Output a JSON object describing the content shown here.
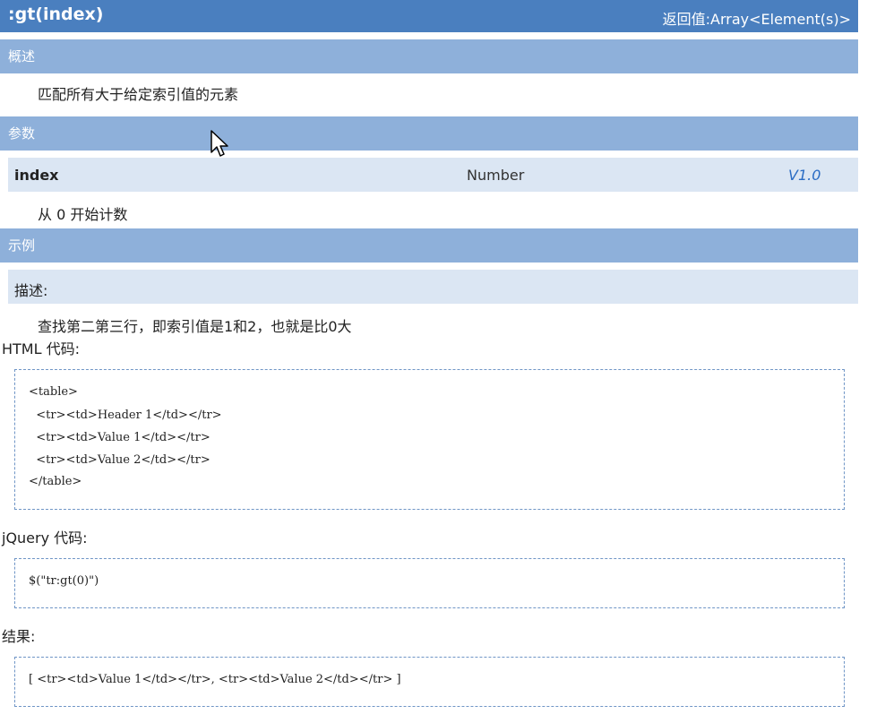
{
  "header": {
    "title": ":gt(index)",
    "return_value": "返回值:Array<Element(s)>"
  },
  "overview": {
    "label": "概述",
    "text": "匹配所有大于给定索引值的元素"
  },
  "params": {
    "label": "参数",
    "name": "index",
    "type": "Number",
    "version": "V1.0",
    "description": "从 0 开始计数"
  },
  "example": {
    "label": "示例",
    "desc_label": "描述:",
    "desc_text": "查找第二第三行，即索引值是1和2，也就是比0大",
    "html_label": "HTML 代码:",
    "html_code": [
      "<table>",
      "  <tr><td>Header 1</td></tr>",
      "  <tr><td>Value 1</td></tr>",
      "  <tr><td>Value 2</td></tr>",
      "</table>"
    ],
    "jquery_label": "jQuery 代码:",
    "jquery_code": "$(\"tr:gt(0)\")",
    "result_label": "结果:",
    "result_code": "[ <tr><td>Value 1</td></tr>, <tr><td>Value 2</td></tr> ]"
  },
  "colors": {
    "title_bg": "#4a7fbf",
    "section_bg": "#8eb0da",
    "subsection_bg": "#dbe6f3",
    "version_text": "#2a6cc4",
    "code_border": "#6f95c6"
  },
  "icons": {
    "cursor": "mouse-pointer-icon"
  }
}
